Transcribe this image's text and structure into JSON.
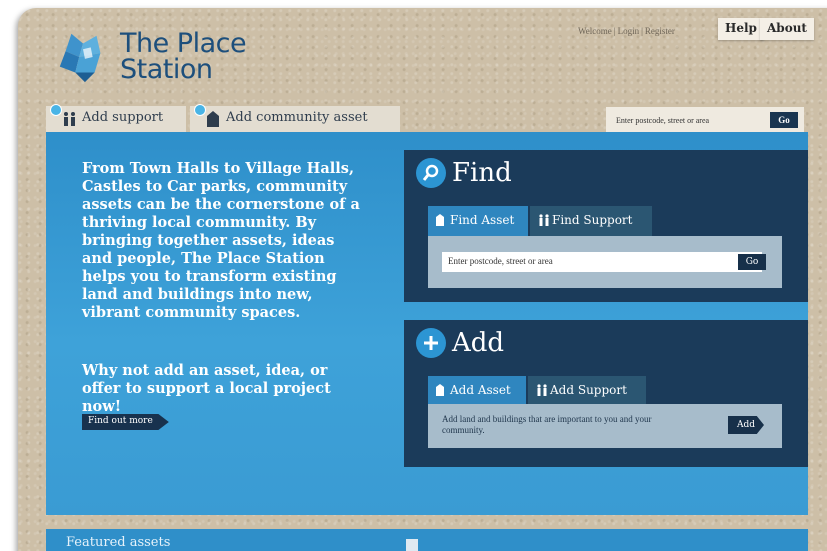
{
  "site": {
    "title_line1": "The Place",
    "title_line2": "Station"
  },
  "header": {
    "welcome": "Welcome",
    "login": "Login",
    "register": "Register",
    "help": "Help",
    "about": "About"
  },
  "tabs": {
    "add_support": "Add support",
    "add_community_asset": "Add community asset"
  },
  "search": {
    "placeholder": "Enter postcode, street or area",
    "go_label": "Go"
  },
  "hero": {
    "intro": "From Town Halls to Village Halls, Castles to Car parks, community assets can be the cornerstone of a thriving local community. By bringing together assets, ideas and people, The Place Station helps you to transform existing land and buildings into new, vibrant community spaces.",
    "cta_text": "Why not add an asset, idea, or offer to support a local project now!",
    "find_out_more": "Find out more"
  },
  "find_panel": {
    "title": "Find",
    "tab_asset": "Find Asset",
    "tab_support": "Find Support",
    "input_placeholder": "Enter postcode, street or area",
    "go_label": "Go"
  },
  "add_panel": {
    "title": "Add",
    "tab_asset": "Add Asset",
    "tab_support": "Add Support",
    "description": "Add land and buildings that are important to you and your community.",
    "add_label": "Add"
  },
  "featured": {
    "title": "Featured assets"
  },
  "colors": {
    "brand_blue": "#1d4f7c",
    "hero_blue": "#3a9bd3",
    "panel_navy": "#1b3b5a",
    "accent_light_blue": "#49b4e6"
  }
}
